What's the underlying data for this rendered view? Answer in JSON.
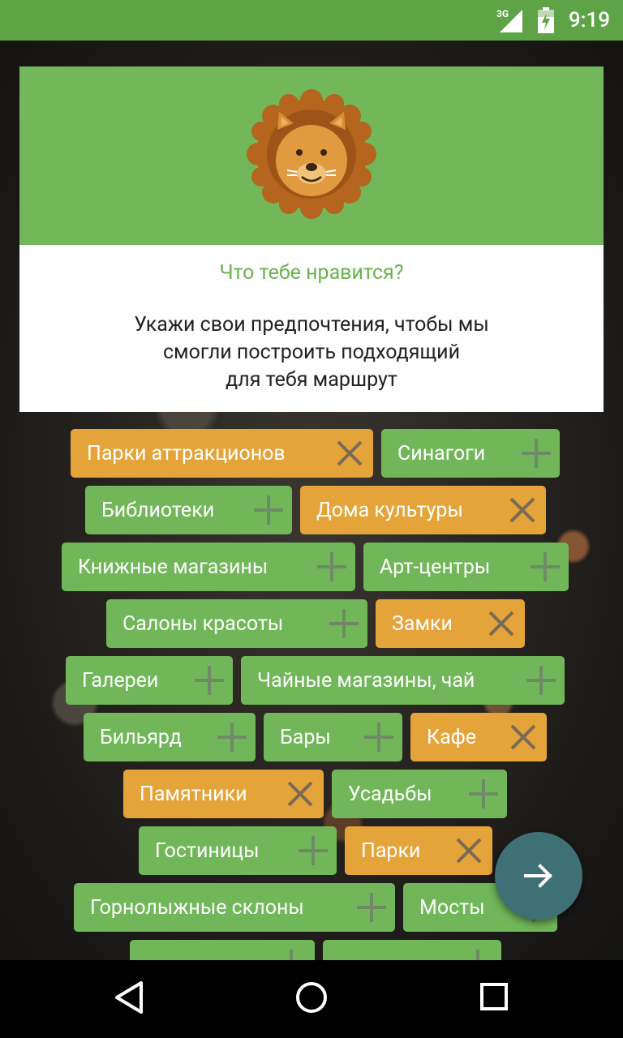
{
  "status_bar": {
    "network": "3G",
    "time": "9:19"
  },
  "card": {
    "title": "Что тебе нравится?",
    "body_lines": [
      "Укажи свои предпочтения, чтобы мы",
      "смогли построить подходящий",
      "для тебя маршрут"
    ]
  },
  "chips": [
    {
      "label": "Парки аттракционов",
      "selected": true
    },
    {
      "label": "Синагоги",
      "selected": false
    },
    {
      "label": "Библиотеки",
      "selected": false
    },
    {
      "label": "Дома культуры",
      "selected": true
    },
    {
      "label": "Книжные магазины",
      "selected": false
    },
    {
      "label": "Арт-центры",
      "selected": false
    },
    {
      "label": "Салоны красоты",
      "selected": false
    },
    {
      "label": "Замки",
      "selected": true
    },
    {
      "label": "Галереи",
      "selected": false
    },
    {
      "label": "Чайные магазины, чай",
      "selected": false
    },
    {
      "label": "Бильярд",
      "selected": false
    },
    {
      "label": "Бары",
      "selected": false
    },
    {
      "label": "Кафе",
      "selected": true
    },
    {
      "label": "Памятники",
      "selected": true
    },
    {
      "label": "Усадьбы",
      "selected": false
    },
    {
      "label": "Гостиницы",
      "selected": false
    },
    {
      "label": "Парки",
      "selected": true
    },
    {
      "label": "Горнолыжные склоны",
      "selected": false
    },
    {
      "label": "Мосты",
      "selected": false
    },
    {
      "label": "",
      "selected": false
    },
    {
      "label": "",
      "selected": false
    }
  ],
  "icons": {
    "add": "plus-icon",
    "remove": "close-icon",
    "next": "arrow-right-icon",
    "nav_back": "back-triangle-icon",
    "nav_home": "home-circle-icon",
    "nav_recents": "recents-square-icon"
  },
  "colors": {
    "status_bar": "#5ea446",
    "header_green": "#72b85a",
    "chip_green": "#71b75a",
    "chip_orange": "#e4a43a",
    "title_green": "#6ab24e",
    "fab": "#3f7076"
  }
}
